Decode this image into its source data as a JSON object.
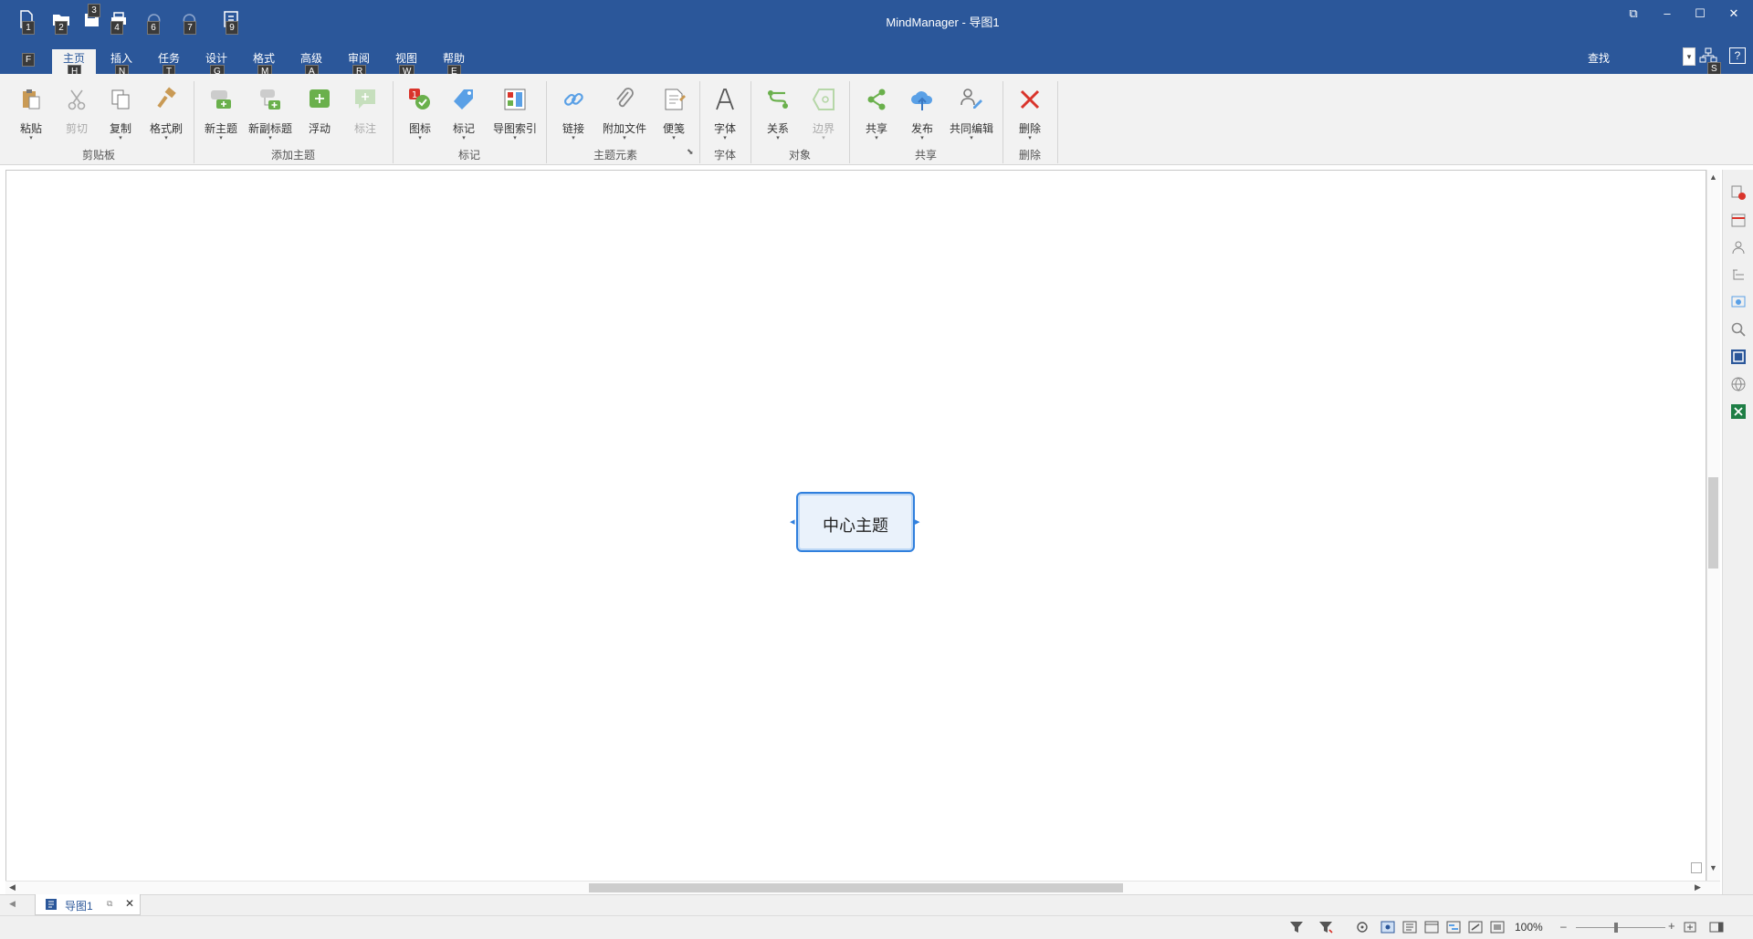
{
  "window": {
    "title": "MindManager - 导图1",
    "restore_glyph": "⧉",
    "minimize_glyph": "–",
    "maximize_glyph": "☐",
    "close_glyph": "✕"
  },
  "quick_access": {
    "keytips": [
      "1",
      "2",
      "3",
      "4",
      "6",
      "7",
      "9"
    ],
    "icons": [
      "new-document-icon",
      "open-folder-icon",
      "save-icon",
      "print-icon",
      "undo-icon",
      "redo-icon",
      "template-icon"
    ]
  },
  "ribbon_tabs": [
    {
      "label": "F",
      "keytip": ""
    },
    {
      "label": "主页",
      "keytip": "H"
    },
    {
      "label": "插入",
      "keytip": "N"
    },
    {
      "label": "任务",
      "keytip": "T"
    },
    {
      "label": "设计",
      "keytip": "G"
    },
    {
      "label": "格式",
      "keytip": "M"
    },
    {
      "label": "高级",
      "keytip": "A"
    },
    {
      "label": "审阅",
      "keytip": "R"
    },
    {
      "label": "视图",
      "keytip": "W"
    },
    {
      "label": "帮助",
      "keytip": "E"
    }
  ],
  "search": {
    "label": "查找",
    "keytip": "S",
    "dropdown_glyph": "▾",
    "help_glyph": "?"
  },
  "ribbon": {
    "buttons": [
      {
        "label": "粘贴",
        "icon": "paste-icon",
        "enabled": true
      },
      {
        "label": "剪切",
        "icon": "scissors-icon",
        "enabled": false
      },
      {
        "label": "复制",
        "icon": "copy-icon",
        "enabled": true
      },
      {
        "label": "格式刷",
        "icon": "format-painter-icon",
        "enabled": true
      },
      {
        "label": "新主题",
        "icon": "new-topic-icon",
        "enabled": true
      },
      {
        "label": "新副标题",
        "icon": "new-subtopic-icon",
        "enabled": true
      },
      {
        "label": "浮动",
        "icon": "floating-topic-icon",
        "enabled": true
      },
      {
        "label": "标注",
        "icon": "callout-icon",
        "enabled": false
      },
      {
        "label": "图标",
        "icon": "icon-marker-icon",
        "enabled": true
      },
      {
        "label": "标记",
        "icon": "tag-icon",
        "enabled": true
      },
      {
        "label": "导图索引",
        "icon": "map-index-icon",
        "enabled": true
      },
      {
        "label": "链接",
        "icon": "link-icon",
        "enabled": true
      },
      {
        "label": "附加文件",
        "icon": "paperclip-icon",
        "enabled": true
      },
      {
        "label": "便笺",
        "icon": "notes-icon",
        "enabled": true
      },
      {
        "label": "字体",
        "icon": "font-icon",
        "enabled": true
      },
      {
        "label": "关系",
        "icon": "relationship-icon",
        "enabled": true
      },
      {
        "label": "边界",
        "icon": "boundary-icon",
        "enabled": false
      },
      {
        "label": "共享",
        "icon": "share-icon",
        "enabled": true
      },
      {
        "label": "发布",
        "icon": "cloud-publish-icon",
        "enabled": true
      },
      {
        "label": "共同编辑",
        "icon": "co-edit-icon",
        "enabled": true
      },
      {
        "label": "删除",
        "icon": "delete-icon",
        "enabled": true
      }
    ],
    "groups": [
      "剪贴板",
      "添加主题",
      "标记",
      "主题元素",
      "字体",
      "对象",
      "共享",
      "删除"
    ]
  },
  "canvas": {
    "central_topic": "中心主题"
  },
  "document_tab": {
    "label": "导图1",
    "close_glyph": "✕"
  },
  "status": {
    "zoom": "100%",
    "zoom_minus": "–",
    "zoom_plus": "+"
  },
  "colors": {
    "title_bar": "#2b579a",
    "ribbon_bg": "#f2f2f2",
    "topic_border": "#2f7fdd",
    "topic_fill": "#eaf2fb"
  }
}
